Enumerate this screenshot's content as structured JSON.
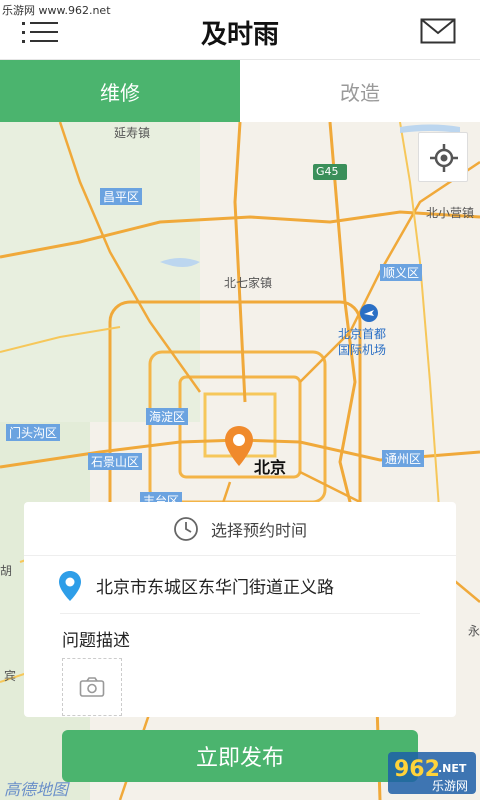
{
  "watermark": "乐游网 www.962.net",
  "header": {
    "title": "及时雨"
  },
  "tabs": [
    {
      "label": "维修"
    },
    {
      "label": "改造"
    }
  ],
  "map": {
    "labels": {
      "yanshou": "延寿镇",
      "changping": "昌平区",
      "g45": "G45",
      "beixiaoying": "北小营镇",
      "beiqijia": "北七家镇",
      "shunyi": "顺义区",
      "airport_line1": "北京首都",
      "airport_line2": "国际机场",
      "haidian": "海淀区",
      "mentougou": "门头沟区",
      "shijingshan": "石景山区",
      "beijing": "北京",
      "tongzhou": "通州区",
      "fengtai": "丰台区",
      "hu": "胡",
      "bin": "宾",
      "yong": "永"
    }
  },
  "card": {
    "time_label": "选择预约时间",
    "address": "北京市东城区东华门街道正义路",
    "description_label": "问题描述"
  },
  "publish_button": "立即发布",
  "map_logo": "高德地图",
  "watermark_logo": {
    "number": "962",
    "suffix": ".NET",
    "site": "乐游网"
  },
  "colors": {
    "accent": "#4bb46e",
    "pin": "#f08a2c",
    "location_pin": "#2e9ee8"
  },
  "icons": [
    "menu-icon",
    "mail-icon",
    "locate-icon",
    "clock-icon",
    "location-pin-icon",
    "camera-icon",
    "map-marker-icon",
    "airport-icon"
  ]
}
